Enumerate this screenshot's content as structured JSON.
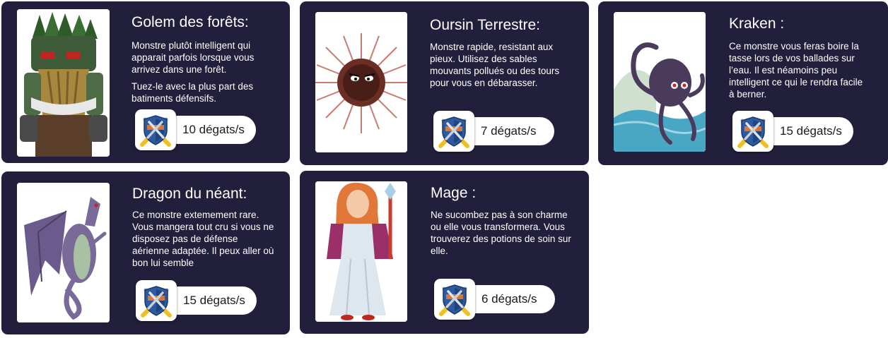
{
  "colors": {
    "card_bg": "#211f3b",
    "text": "#ffffff",
    "pill_bg": "#ffffff",
    "shield_blue": "#2d5aa0",
    "shield_orange": "#e07a2e"
  },
  "badge_icon": "shield-crossed-swords-icon",
  "cards": [
    {
      "id": "golem",
      "title": "Golem des forêts:",
      "description": [
        "Monstre plutôt intelligent qui apparait parfois lorsque vous arrivez dans une forêt.",
        "Tuez-le avec la plus part des batiments défensifs."
      ],
      "damage": "10 dégats/s"
    },
    {
      "id": "oursin",
      "title": "Oursin Terrestre:",
      "description": [
        "Monstre rapide, resistant aux pieux. Utilisez des sables mouvants pollués ou des tours pour vous en débarasser."
      ],
      "damage": "7 dégats/s"
    },
    {
      "id": "kraken",
      "title": "Kraken :",
      "description": [
        "Ce monstre vous feras boire la tasse lors de vos ballades sur l’eau. Il est néamoins peu intelligent ce qui le rendra facile à berner."
      ],
      "damage": "15 dégats/s"
    },
    {
      "id": "dragon",
      "title": "Dragon du néant:",
      "description": [
        "Ce monstre extemement rare. Vous mangera tout cru si vous ne disposez pas de défense aérienne adaptée. Il peux aller où bon lui semble"
      ],
      "damage": "15 dégats/s"
    },
    {
      "id": "mage",
      "title": "Mage :",
      "description": [
        "Ne sucombez pas à son charme ou elle vous transformera. Vous trouverez des potions de soin sur elle."
      ],
      "damage": "6 dégats/s"
    }
  ]
}
